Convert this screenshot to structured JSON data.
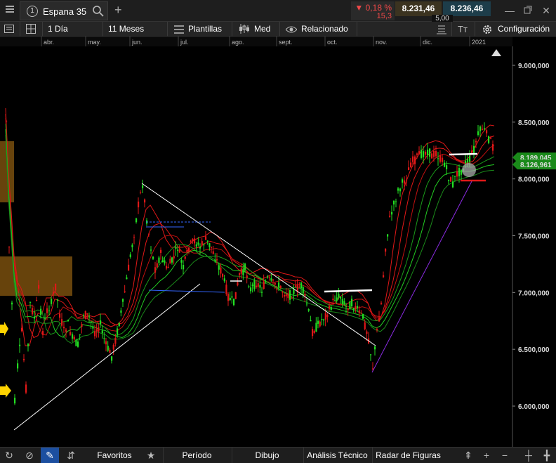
{
  "tab": {
    "number": "1",
    "instrument": "Espana 35"
  },
  "quote": {
    "change_pct": "▼ 0,18 %",
    "change_abs": "15,3",
    "bid": "8.231,46",
    "ask": "8.236,46",
    "spread": "5,00"
  },
  "toolbar": {
    "interval": "1 Día",
    "range": "11 Meses",
    "templates": "Plantillas",
    "chart_style": "Med",
    "related": "Relacionado",
    "settings": "Configuración"
  },
  "bottom": {
    "favorites": "Favoritos",
    "period": "Período",
    "drawing": "Dibujo",
    "technical": "Análisis Técnico",
    "pattern_radar": "Radar de Figuras"
  },
  "colors": {
    "up": "#22dd22",
    "down": "#e01818",
    "price_tag": "#1a8a1a",
    "zone": "#8a5a10"
  },
  "chart_data": {
    "type": "candlestick",
    "x_labels": [
      "abr.",
      "may.",
      "jun.",
      "jul.",
      "ago.",
      "sept.",
      "oct.",
      "nov.",
      "dic.",
      "2021"
    ],
    "y_ticks": [
      "9.000,000",
      "8.500,000",
      "8.000,000",
      "7.500,000",
      "7.000,000",
      "6.500,000",
      "6.000,000"
    ],
    "y_tick_values": [
      9000,
      8500,
      8000,
      7500,
      7000,
      6500,
      6000
    ],
    "ylim": [
      5700,
      9150
    ],
    "price_tags": [
      "8.189,045",
      "8.126,961"
    ],
    "price_tag_values": [
      8189.045,
      8126.961
    ]
  }
}
